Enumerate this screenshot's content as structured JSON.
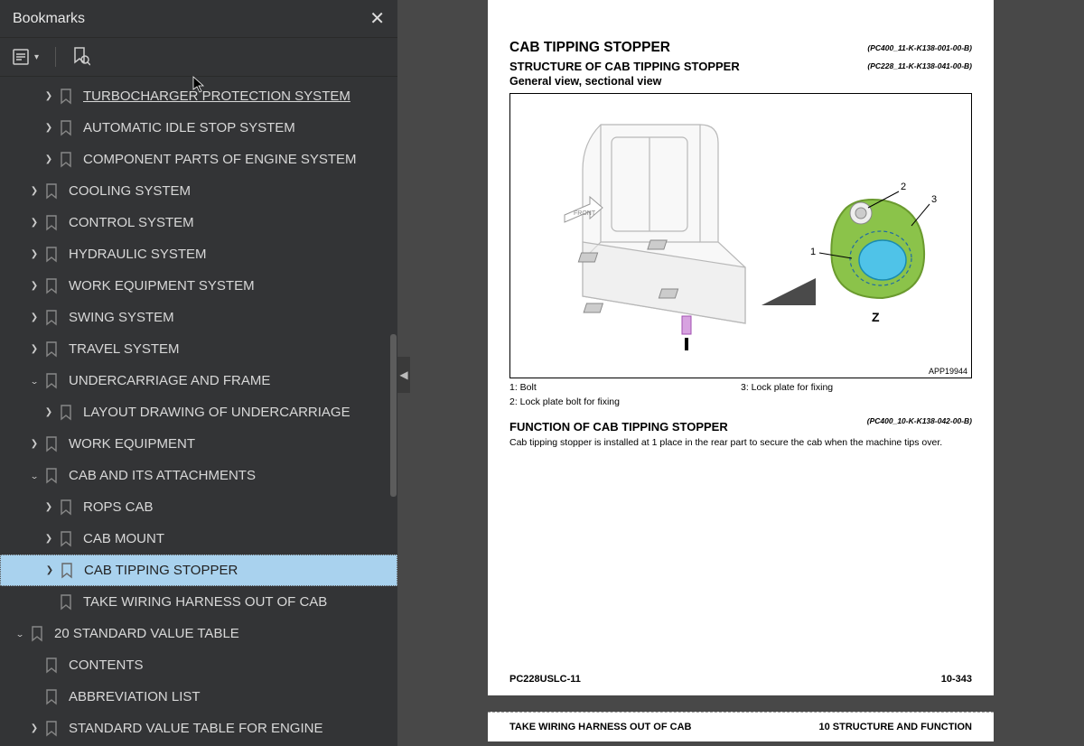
{
  "sidebar": {
    "title": "Bookmarks",
    "items": [
      {
        "indent": 2,
        "chev": "›",
        "label": "TURBOCHARGER PROTECTION SYSTEM",
        "underline": true
      },
      {
        "indent": 2,
        "chev": "›",
        "label": "AUTOMATIC IDLE STOP SYSTEM"
      },
      {
        "indent": 2,
        "chev": "›",
        "label": "COMPONENT PARTS OF ENGINE SYSTEM"
      },
      {
        "indent": 1,
        "chev": "›",
        "label": "COOLING SYSTEM"
      },
      {
        "indent": 1,
        "chev": "›",
        "label": "CONTROL SYSTEM"
      },
      {
        "indent": 1,
        "chev": "›",
        "label": "HYDRAULIC SYSTEM"
      },
      {
        "indent": 1,
        "chev": "›",
        "label": "WORK EQUIPMENT SYSTEM"
      },
      {
        "indent": 1,
        "chev": "›",
        "label": "SWING SYSTEM"
      },
      {
        "indent": 1,
        "chev": "›",
        "label": "TRAVEL SYSTEM"
      },
      {
        "indent": 1,
        "chev": "⌄",
        "label": "UNDERCARRIAGE AND FRAME"
      },
      {
        "indent": 2,
        "chev": "›",
        "label": "LAYOUT DRAWING OF UNDERCARRIAGE"
      },
      {
        "indent": 1,
        "chev": "›",
        "label": "WORK EQUIPMENT"
      },
      {
        "indent": 1,
        "chev": "⌄",
        "label": "CAB AND ITS ATTACHMENTS"
      },
      {
        "indent": 2,
        "chev": "›",
        "label": "ROPS CAB"
      },
      {
        "indent": 2,
        "chev": "›",
        "label": "CAB MOUNT"
      },
      {
        "indent": 2,
        "chev": "›",
        "label": "CAB TIPPING STOPPER",
        "selected": true
      },
      {
        "indent": 2,
        "chev": "",
        "label": "TAKE WIRING HARNESS OUT OF CAB"
      },
      {
        "indent": 0,
        "chev": "⌄",
        "label": "20 STANDARD VALUE TABLE"
      },
      {
        "indent": 1,
        "chev": "",
        "label": "CONTENTS"
      },
      {
        "indent": 1,
        "chev": "",
        "label": "ABBREVIATION LIST"
      },
      {
        "indent": 1,
        "chev": "›",
        "label": "STANDARD VALUE TABLE FOR ENGINE"
      }
    ]
  },
  "page": {
    "h1": "CAB TIPPING STOPPER",
    "h2": "STRUCTURE OF CAB TIPPING STOPPER",
    "h3": "General view, sectional view",
    "ref1": "(PC400_11-K-K138-001-00-B)",
    "ref2": "(PC228_11-K-K138-041-00-B)",
    "ref3": "(PC400_10-K-K138-042-00-B)",
    "diag_code": "APP19944",
    "section_letter": "Z",
    "callout_1": "1",
    "callout_2": "2",
    "callout_3": "3",
    "front_label": "FRONT",
    "legend_1": "1: Bolt",
    "legend_2": "2: Lock plate bolt for fixing",
    "legend_3": "3: Lock plate for fixing",
    "func_h": "FUNCTION OF CAB TIPPING STOPPER",
    "func_body": "Cab tipping stopper is installed at 1 place in the rear part to secure the cab when the machine tips over.",
    "footer_left": "PC228USLC-11",
    "footer_right": "10-343",
    "page2_left": "TAKE WIRING HARNESS OUT OF CAB",
    "page2_right": "10 STRUCTURE AND FUNCTION"
  }
}
